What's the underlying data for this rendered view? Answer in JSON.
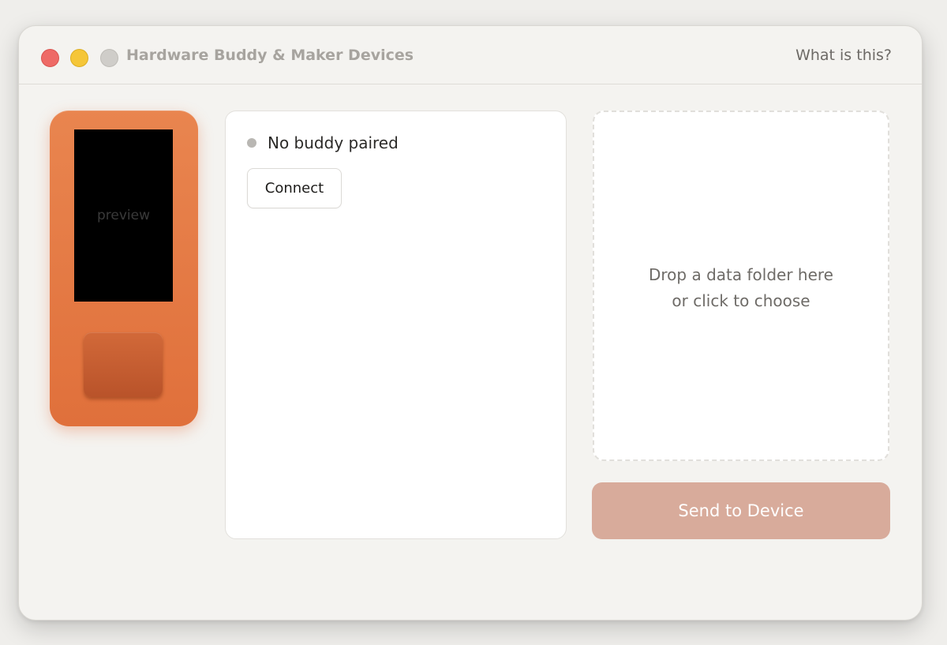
{
  "window": {
    "title": "Hardware Buddy & Maker Devices",
    "help_link": "What is this?"
  },
  "device": {
    "screen_label": "preview",
    "body_color": "#e47a45",
    "screen_color": "#000000"
  },
  "status": {
    "text": "No buddy paired",
    "state": "unpaired",
    "dot_color": "#b9b7b3",
    "connect_label": "Connect"
  },
  "dropzone": {
    "line1": "Drop a data folder here",
    "line2": "or click to choose"
  },
  "send": {
    "label": "Send to Device",
    "enabled": false,
    "color": "#d8ab9b"
  }
}
